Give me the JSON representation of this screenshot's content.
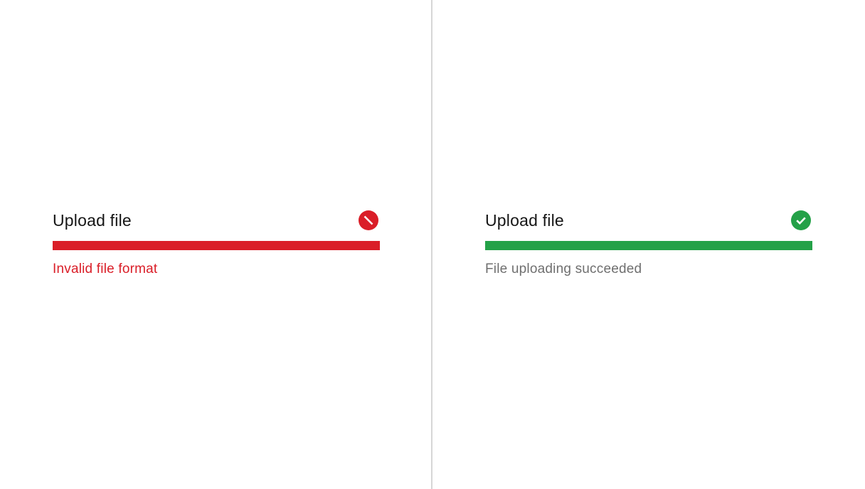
{
  "error_upload": {
    "title": "Upload file",
    "status_icon": "error-blocked-icon",
    "progress": 1.0,
    "helper_text": "Invalid file format",
    "color": "#da1e28",
    "helper_color": "#da1e28"
  },
  "success_upload": {
    "title": "Upload file",
    "status_icon": "checkmark-filled-icon",
    "progress": 1.0,
    "helper_text": "File uploading succeeded",
    "color": "#24a148",
    "helper_color": "#6f6f6f"
  }
}
